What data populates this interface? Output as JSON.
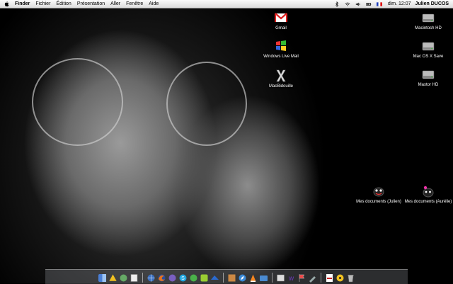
{
  "menubar": {
    "items": [
      {
        "label": "Finder",
        "bold": true
      },
      {
        "label": "Fichier"
      },
      {
        "label": "Édition"
      },
      {
        "label": "Présentation"
      },
      {
        "label": "Aller"
      },
      {
        "label": "Fenêtre"
      },
      {
        "label": "Aide"
      }
    ],
    "clock": "dim. 12:07",
    "user": "Julien DUCOS",
    "tray_icons": [
      "bluetooth-icon",
      "airport-wifi-icon",
      "volume-icon",
      "battery-icon",
      "french-flag-icon"
    ]
  },
  "desktop": {
    "icons": [
      {
        "label": "Gmail",
        "icon": "gmail-icon"
      },
      {
        "label": "Windows Live Mail",
        "icon": "windows-live-mail-icon"
      },
      {
        "label": "MacBidouille",
        "icon": "mac-x-icon"
      },
      {
        "label": "Macintosh HD",
        "icon": "hard-drive-icon"
      },
      {
        "label": "Mac OS X Save",
        "icon": "hard-drive-icon"
      },
      {
        "label": "Maxtor HD",
        "icon": "hard-drive-icon"
      },
      {
        "label": "Mes documents (Julien)",
        "icon": "ladybug-folder-icon"
      },
      {
        "label": "Mes documents (Aurélie)",
        "icon": "flower-ladybug-folder-icon"
      }
    ]
  },
  "dock": {
    "items": [
      "finder-icon",
      "system-prefs-icon",
      "vlc-like-icon",
      "preview-icon",
      "network-icon",
      "firefox-icon",
      "itunes-icon",
      "skype-icon",
      "chat-icon",
      "app-icon",
      "photo-icon",
      "maps-icon",
      "safari-icon",
      "vlc-icon",
      "folder-icon",
      "utilities-icon",
      "web-icon",
      "flag-icon",
      "tool-icon",
      "pdf-icon",
      "warning-icon",
      "trash-icon"
    ]
  }
}
